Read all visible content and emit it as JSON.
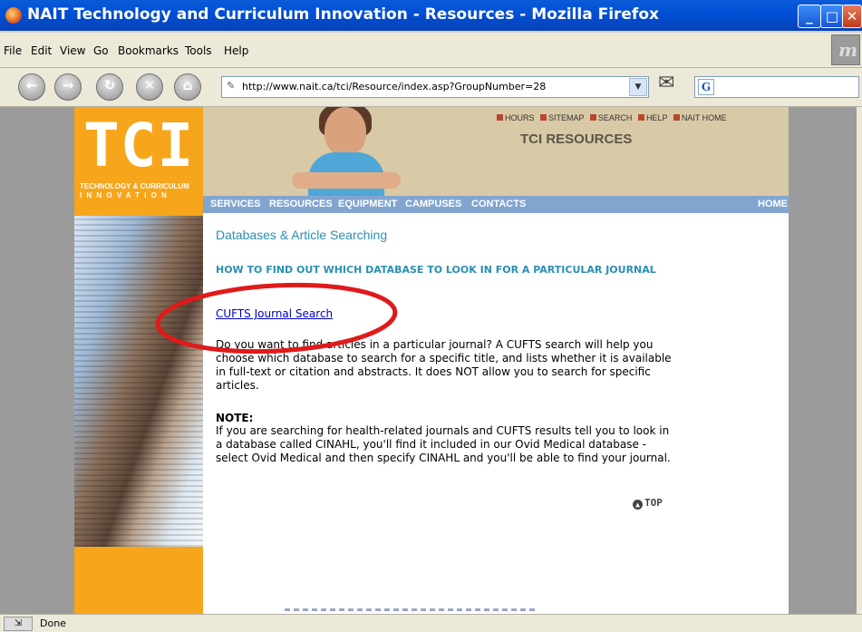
{
  "window": {
    "title": "NAIT Technology and Curriculum Innovation - Resources - Mozilla Firefox",
    "controls": {
      "minimize": "_",
      "maximize": "□",
      "close": "✕"
    }
  },
  "menubar": {
    "items": [
      "File",
      "Edit",
      "View",
      "Go",
      "Bookmarks",
      "Tools",
      "Help"
    ]
  },
  "toolbar": {
    "url": "http://www.nait.ca/tci/Resource/index.asp?GroupNumber=28",
    "search_engine_letter": "G"
  },
  "site": {
    "logo": "TCI",
    "logo_sub1": "TECHNOLOGY & CURRICULUM",
    "logo_sub2": "INNOVATION",
    "top_links": [
      "HOURS",
      "SITEMAP",
      "SEARCH",
      "HELP",
      "NAIT HOME"
    ],
    "section_title": "TCI RESOURCES",
    "nav": [
      "SERVICES",
      "RESOURCES",
      "EQUIPMENT",
      "CAMPUSES",
      "CONTACTS"
    ],
    "nav_home": "HOME"
  },
  "content": {
    "heading": "Databases & Article Searching",
    "howto": "HOW TO FIND OUT WHICH DATABASE TO LOOK IN FOR A PARTICULAR JOURNAL",
    "link": "CUFTS Journal Search",
    "paragraph": "Do you want to find articles in a particular journal? A CUFTS search will help you choose which database to search for a specific title, and lists whether it is available in full-text or citation and abstracts. It does NOT allow you to search for specific articles.",
    "note_heading": "NOTE:",
    "note": "If you are searching for health-related journals and CUFTS results tell you to look in a database called CINAHL, you'll find it included in our Ovid Medical database - select Ovid Medical and then specify CINAHL and you'll be able to find your journal.",
    "top_label": "TOP"
  },
  "status": {
    "text": "Done"
  }
}
